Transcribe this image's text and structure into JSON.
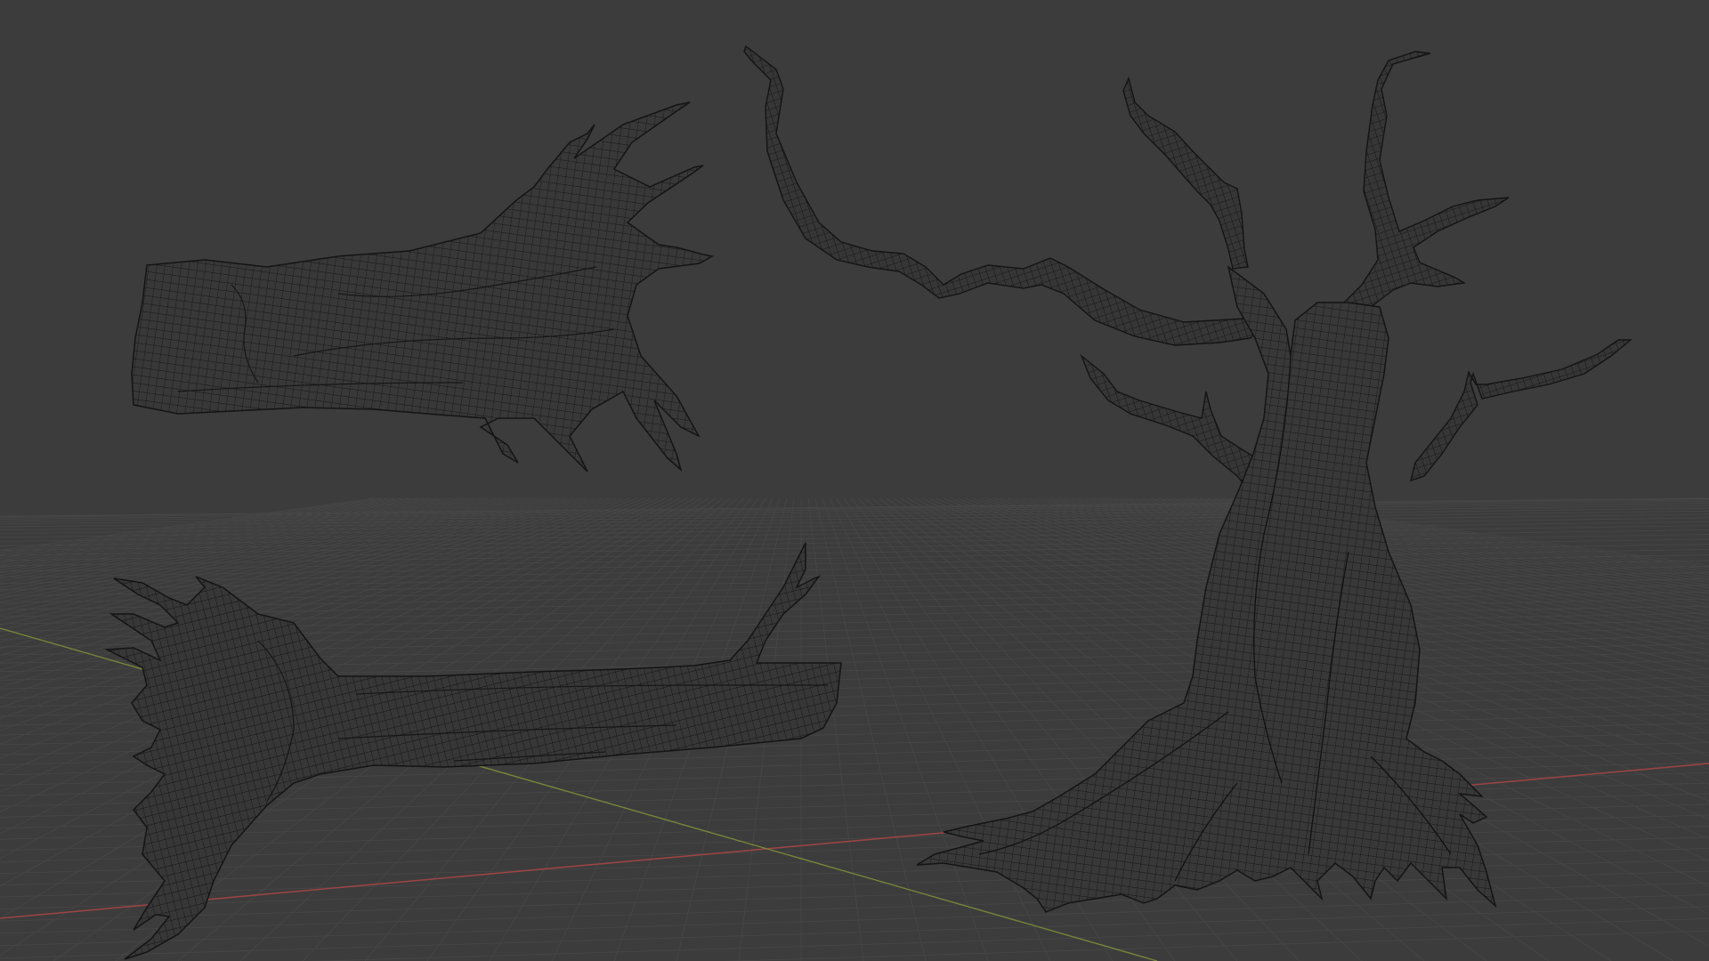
{
  "viewport": {
    "mode": "wireframe-3d-view",
    "background_color": "#3c3c3c",
    "grid_color": "#474747",
    "x_axis_color": "#a04848",
    "y_axis_color": "#7a8a3a",
    "wire_color": "#151515",
    "mesh_fill_color": "#383838"
  },
  "objects": [
    {
      "name": "log-with-roots-top"
    },
    {
      "name": "log-with-roots-bottom"
    },
    {
      "name": "dead-tree"
    }
  ]
}
